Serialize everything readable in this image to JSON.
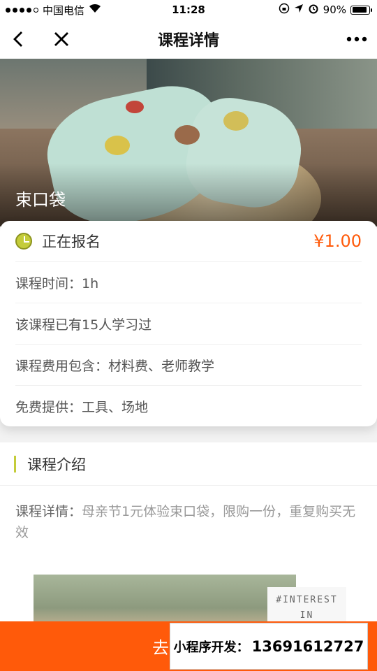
{
  "status_bar": {
    "carrier": "中国电信",
    "time": "11:28",
    "battery": "90%",
    "battery_level": 0.9
  },
  "nav": {
    "title": "课程详情",
    "back_icon": "chevron-left-icon",
    "close_icon": "close-icon",
    "more_icon": "more-icon"
  },
  "hero": {
    "title": "束口袋"
  },
  "course": {
    "status": "正在报名",
    "price": "¥1.00",
    "rows": [
      "课程时间：1h",
      "该课程已有15人学习过",
      "课程费用包含：材料费、老师教学",
      "免费提供：工具、场地"
    ]
  },
  "intro": {
    "title": "课程介绍",
    "detail_label": "课程详情：",
    "detail_text": "母亲节1元体验束口袋，限购一份，重复购买无效",
    "photo_caption_1": "#INTEREST",
    "photo_caption_2": "IN"
  },
  "bottom": {
    "button_label": "去",
    "promo_label": "小程序开发：",
    "promo_phone": "13691612727"
  },
  "colors": {
    "accent_orange": "#ff5a0a",
    "accent_lime": "#c4cc3a"
  }
}
